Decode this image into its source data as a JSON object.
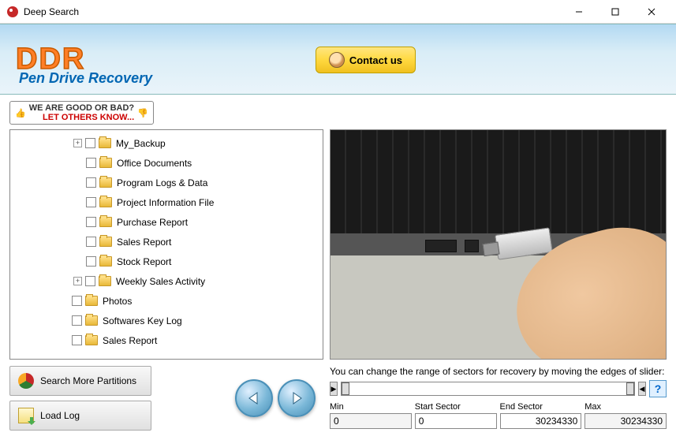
{
  "window": {
    "title": "Deep Search"
  },
  "header": {
    "logo": "DDR",
    "tagline": "Pen Drive Recovery",
    "contact_label": "Contact us"
  },
  "feedback": {
    "line1": "WE ARE GOOD OR BAD?",
    "line2": "LET OTHERS KNOW..."
  },
  "tree": {
    "items": [
      {
        "label": "My_Backup",
        "level": 2,
        "expandable": true
      },
      {
        "label": "Office Documents",
        "level": 2,
        "expandable": false
      },
      {
        "label": "Program Logs & Data",
        "level": 2,
        "expandable": false
      },
      {
        "label": "Project Information File",
        "level": 2,
        "expandable": false
      },
      {
        "label": "Purchase Report",
        "level": 2,
        "expandable": false
      },
      {
        "label": "Sales Report",
        "level": 2,
        "expandable": false
      },
      {
        "label": "Stock Report",
        "level": 2,
        "expandable": false
      },
      {
        "label": "Weekly Sales Activity",
        "level": 2,
        "expandable": true
      },
      {
        "label": "Photos",
        "level": 1,
        "expandable": false
      },
      {
        "label": "Softwares Key Log",
        "level": 1,
        "expandable": false
      },
      {
        "label": "Sales Report",
        "level": 1,
        "expandable": false
      }
    ]
  },
  "buttons": {
    "search_partitions": "Search More Partitions",
    "load_log": "Load Log"
  },
  "sector": {
    "instruction": "You can change the range of sectors for recovery by moving the edges of slider:",
    "min_label": "Min",
    "start_label": "Start Sector",
    "end_label": "End Sector",
    "max_label": "Max",
    "min_value": "0",
    "start_value": "0",
    "end_value": "30234330",
    "max_value": "30234330",
    "help": "?"
  }
}
